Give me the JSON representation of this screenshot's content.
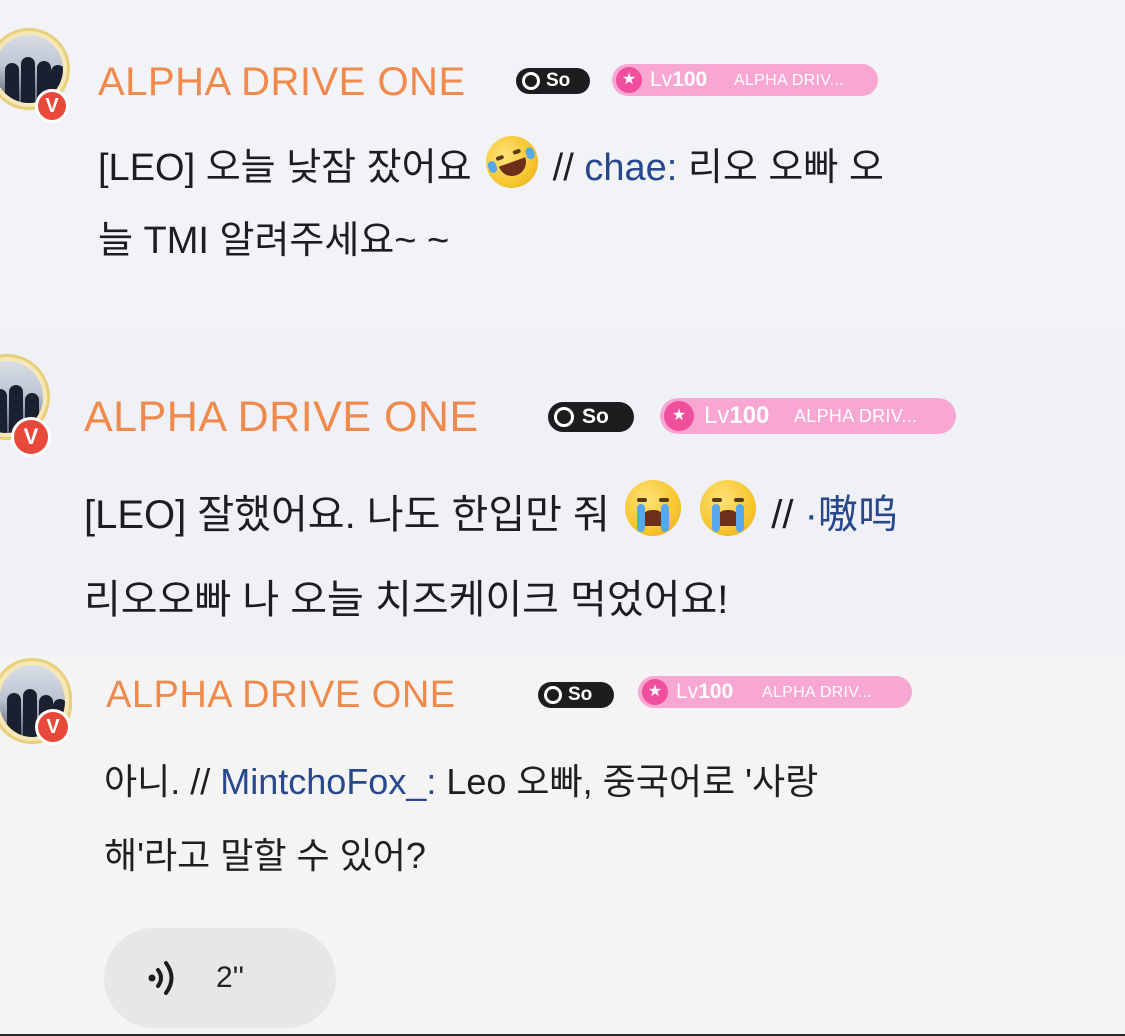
{
  "messages": [
    {
      "author": "ALPHA DRIVE ONE",
      "so_badge": "So",
      "level": {
        "prefix": "Lv",
        "number": "100",
        "club": "ALPHA DRIV..."
      },
      "verified": "V",
      "line1": {
        "pre": "[LEO] 오늘 낮잠 잤어요",
        "emoji": "rolling-on-floor-laughing",
        "post": " //",
        "mention": "chae:",
        "tail": " 리오 오빠 오"
      },
      "line2": "늘 TMI 알려주세요~ ~"
    },
    {
      "author": "ALPHA DRIVE ONE",
      "so_badge": "So",
      "level": {
        "prefix": "Lv",
        "number": "100",
        "club": "ALPHA DRIV..."
      },
      "verified": "V",
      "line1": {
        "pre": "[LEO] 잘했어요. 나도 한입만 줘",
        "emoji": "loudly-crying",
        "post": " //",
        "mention": "·嗷呜"
      },
      "line2": "리오오빠 나 오늘 치즈케이크 먹었어요!"
    },
    {
      "author": "ALPHA DRIVE ONE",
      "so_badge": "So",
      "level": {
        "prefix": "Lv",
        "number": "100",
        "club": "ALPHA DRIV..."
      },
      "verified": "V",
      "line1": {
        "pre": "아니. //",
        "mention": "MintchoFox_:",
        "tail": " Leo 오빠, 중국어로 '사랑"
      },
      "line2": "해'라고 말할 수 있어?",
      "voice": {
        "icon": "audio-wave-icon",
        "duration": "2''"
      }
    }
  ],
  "colors": {
    "name": "#ef8a4c",
    "mention": "#27488c",
    "level_badge": "#f8a6d2",
    "level_star": "#ef4f9c",
    "verified": "#e8493a"
  }
}
